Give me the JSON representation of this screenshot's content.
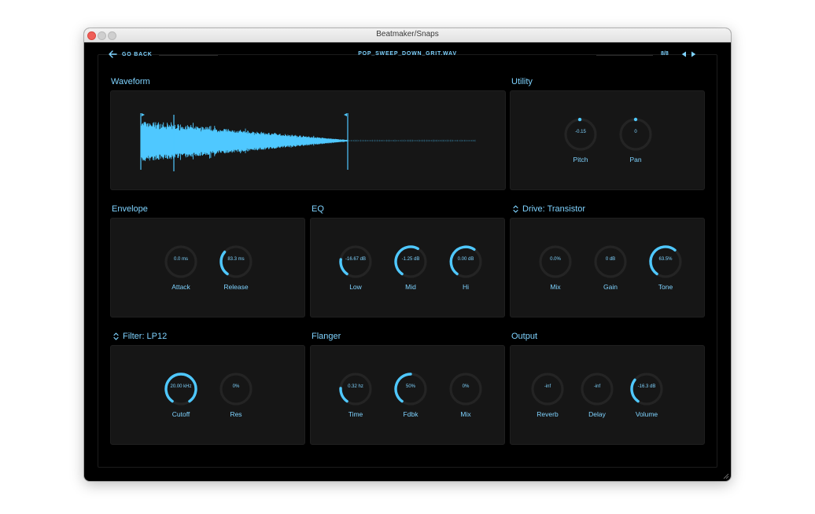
{
  "window": {
    "title": "Beatmaker/Snaps"
  },
  "header": {
    "back_label": "GO BACK",
    "file_name": "POP_SWEEP_DOWN_GRIT.WAV",
    "counter": "8/8"
  },
  "colors": {
    "accent": "#4fc8ff",
    "track": "#242424",
    "panel": "#161616",
    "text": "#7fd3ff"
  },
  "sections": {
    "waveform": {
      "title": "Waveform"
    },
    "utility": {
      "title": "Utility",
      "knobs": [
        {
          "label": "Pitch",
          "value": "-0.15",
          "level": 0.49,
          "mode": "bipolar"
        },
        {
          "label": "Pan",
          "value": "0",
          "level": 0.5,
          "mode": "bipolar"
        }
      ]
    },
    "envelope": {
      "title": "Envelope",
      "knobs": [
        {
          "label": "Attack",
          "value": "0.0 ms",
          "level": 0,
          "mode": "unipolar"
        },
        {
          "label": "Release",
          "value": "83.3 ms",
          "level": 0.33,
          "mode": "unipolar"
        }
      ]
    },
    "eq": {
      "title": "EQ",
      "knobs": [
        {
          "label": "Low",
          "value": "-16.67 dB",
          "level": 0.22,
          "mode": "unipolar"
        },
        {
          "label": "Mid",
          "value": "-1.25 dB",
          "level": 0.6,
          "mode": "unipolar"
        },
        {
          "label": "Hi",
          "value": "0.00 dB",
          "level": 0.62,
          "mode": "unipolar"
        }
      ]
    },
    "drive": {
      "title": "Drive: Transistor",
      "knobs": [
        {
          "label": "Mix",
          "value": "0.0%",
          "level": 0,
          "mode": "unipolar"
        },
        {
          "label": "Gain",
          "value": "0 dB",
          "level": 0,
          "mode": "unipolar"
        },
        {
          "label": "Tone",
          "value": "63.5%",
          "level": 0.635,
          "mode": "unipolar"
        }
      ]
    },
    "filter": {
      "title": "Filter: LP12",
      "knobs": [
        {
          "label": "Cutoff",
          "value": "20.00 kHz",
          "level": 1.0,
          "mode": "unipolar"
        },
        {
          "label": "Res",
          "value": "0%",
          "level": 0,
          "mode": "unipolar"
        }
      ]
    },
    "flanger": {
      "title": "Flanger",
      "knobs": [
        {
          "label": "Time",
          "value": "0.32 hz",
          "level": 0.2,
          "mode": "unipolar"
        },
        {
          "label": "Fdbk",
          "value": "50%",
          "level": 0.5,
          "mode": "unipolar"
        },
        {
          "label": "Mix",
          "value": "0%",
          "level": 0,
          "mode": "unipolar"
        }
      ]
    },
    "output": {
      "title": "Output",
      "knobs": [
        {
          "label": "Reverb",
          "value": "-inf",
          "level": 0,
          "mode": "unipolar"
        },
        {
          "label": "Delay",
          "value": "-inf",
          "level": 0,
          "mode": "unipolar"
        },
        {
          "label": "Volume",
          "value": "-16.3 dB",
          "level": 0.32,
          "mode": "unipolar"
        }
      ]
    }
  }
}
